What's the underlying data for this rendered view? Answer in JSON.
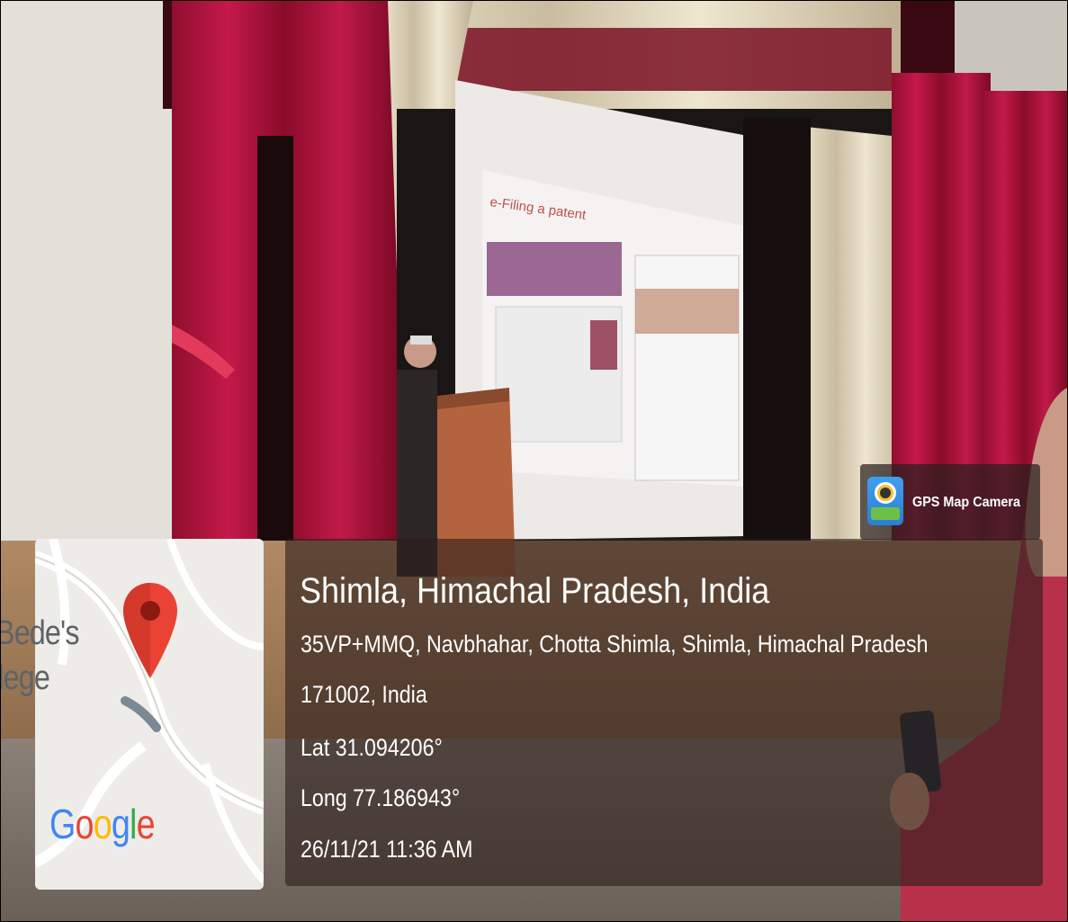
{
  "photo": {
    "slide_title": "e-Filing a patent"
  },
  "gps_app": {
    "name": "GPS Map Camera",
    "icon": "gps-map-camera-app-icon"
  },
  "map": {
    "place_label_line1": "Bede's",
    "place_label_line2": "llege",
    "brand": [
      "G",
      "o",
      "o",
      "g",
      "l",
      "e"
    ],
    "brand_colors": [
      "#4285F4",
      "#EA4335",
      "#FBBC05",
      "#4285F4",
      "#34A853",
      "#EA4335"
    ],
    "pin_icon": "map-pin-icon",
    "pin_color": "#EA4335"
  },
  "location": {
    "title": "Shimla, Himachal Pradesh, India",
    "address_line1": "35VP+MMQ, Navbhahar, Chotta Shimla, Shimla, Himachal Pradesh",
    "address_line2": "171002, India",
    "latitude": "Lat 31.094206°",
    "longitude": "Long 77.186943°",
    "timestamp": "26/11/21 11:36 AM"
  }
}
